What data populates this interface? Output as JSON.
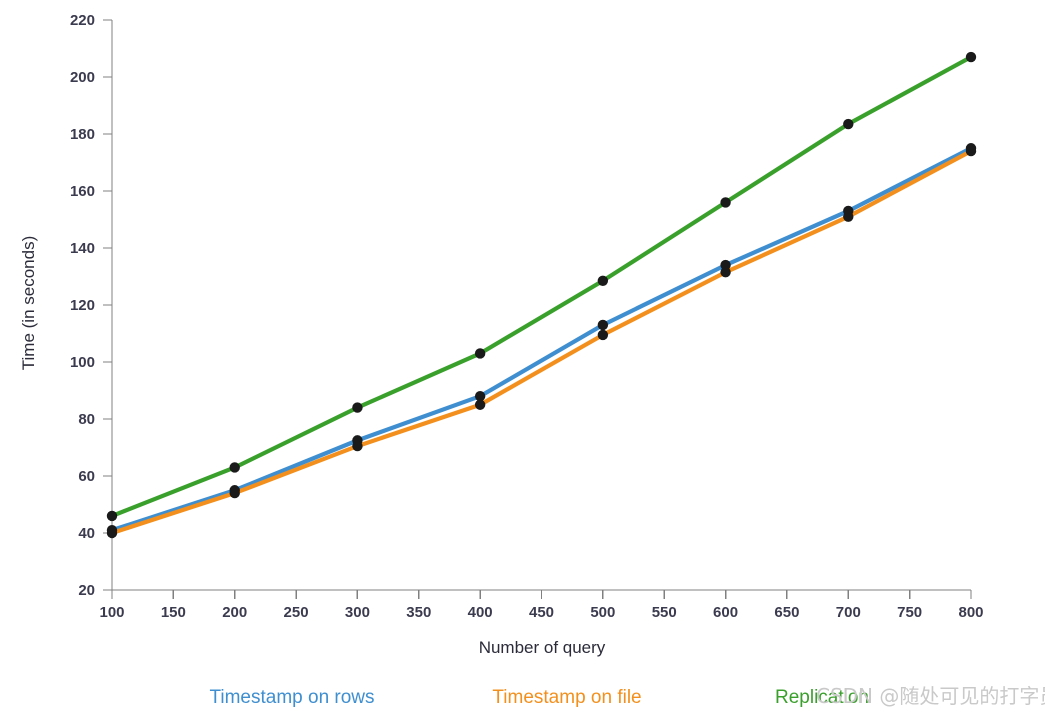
{
  "chart_data": {
    "type": "line",
    "title": "",
    "xlabel": "Number of query",
    "ylabel": "Time (in seconds)",
    "x": [
      100,
      200,
      300,
      400,
      500,
      600,
      700,
      800
    ],
    "xlim": [
      100,
      800
    ],
    "ylim": [
      20,
      220
    ],
    "xticks": [
      100,
      150,
      200,
      250,
      300,
      350,
      400,
      450,
      500,
      550,
      600,
      650,
      700,
      750,
      800
    ],
    "yticks": [
      20,
      40,
      60,
      80,
      100,
      120,
      140,
      160,
      180,
      200,
      220
    ],
    "grid": false,
    "legend_position": "bottom",
    "markers": "filled-circle",
    "marker_color": "#1a1a1a",
    "series": [
      {
        "name": "Timestamp on rows",
        "color": "#3f8fd0",
        "values": [
          41,
          55,
          72.5,
          88,
          113,
          134,
          153,
          175
        ]
      },
      {
        "name": "Timestamp on file",
        "color": "#f3901d",
        "values": [
          40,
          54,
          70.5,
          85,
          109.5,
          131.5,
          151,
          174
        ]
      },
      {
        "name": "Replication",
        "color": "#3aa02c",
        "values": [
          46,
          63,
          84,
          103,
          128.5,
          156,
          183.5,
          207
        ]
      }
    ]
  },
  "legend": {
    "items": [
      {
        "label": "Timestamp on rows",
        "color": "#3f8fd0"
      },
      {
        "label": "Timestamp on file",
        "color": "#f3901d"
      },
      {
        "label": "Replication",
        "color": "#3aa02c"
      }
    ]
  },
  "watermark": {
    "text": "CSDN @随处可见的打字员",
    "color": "#c9c9c9"
  }
}
